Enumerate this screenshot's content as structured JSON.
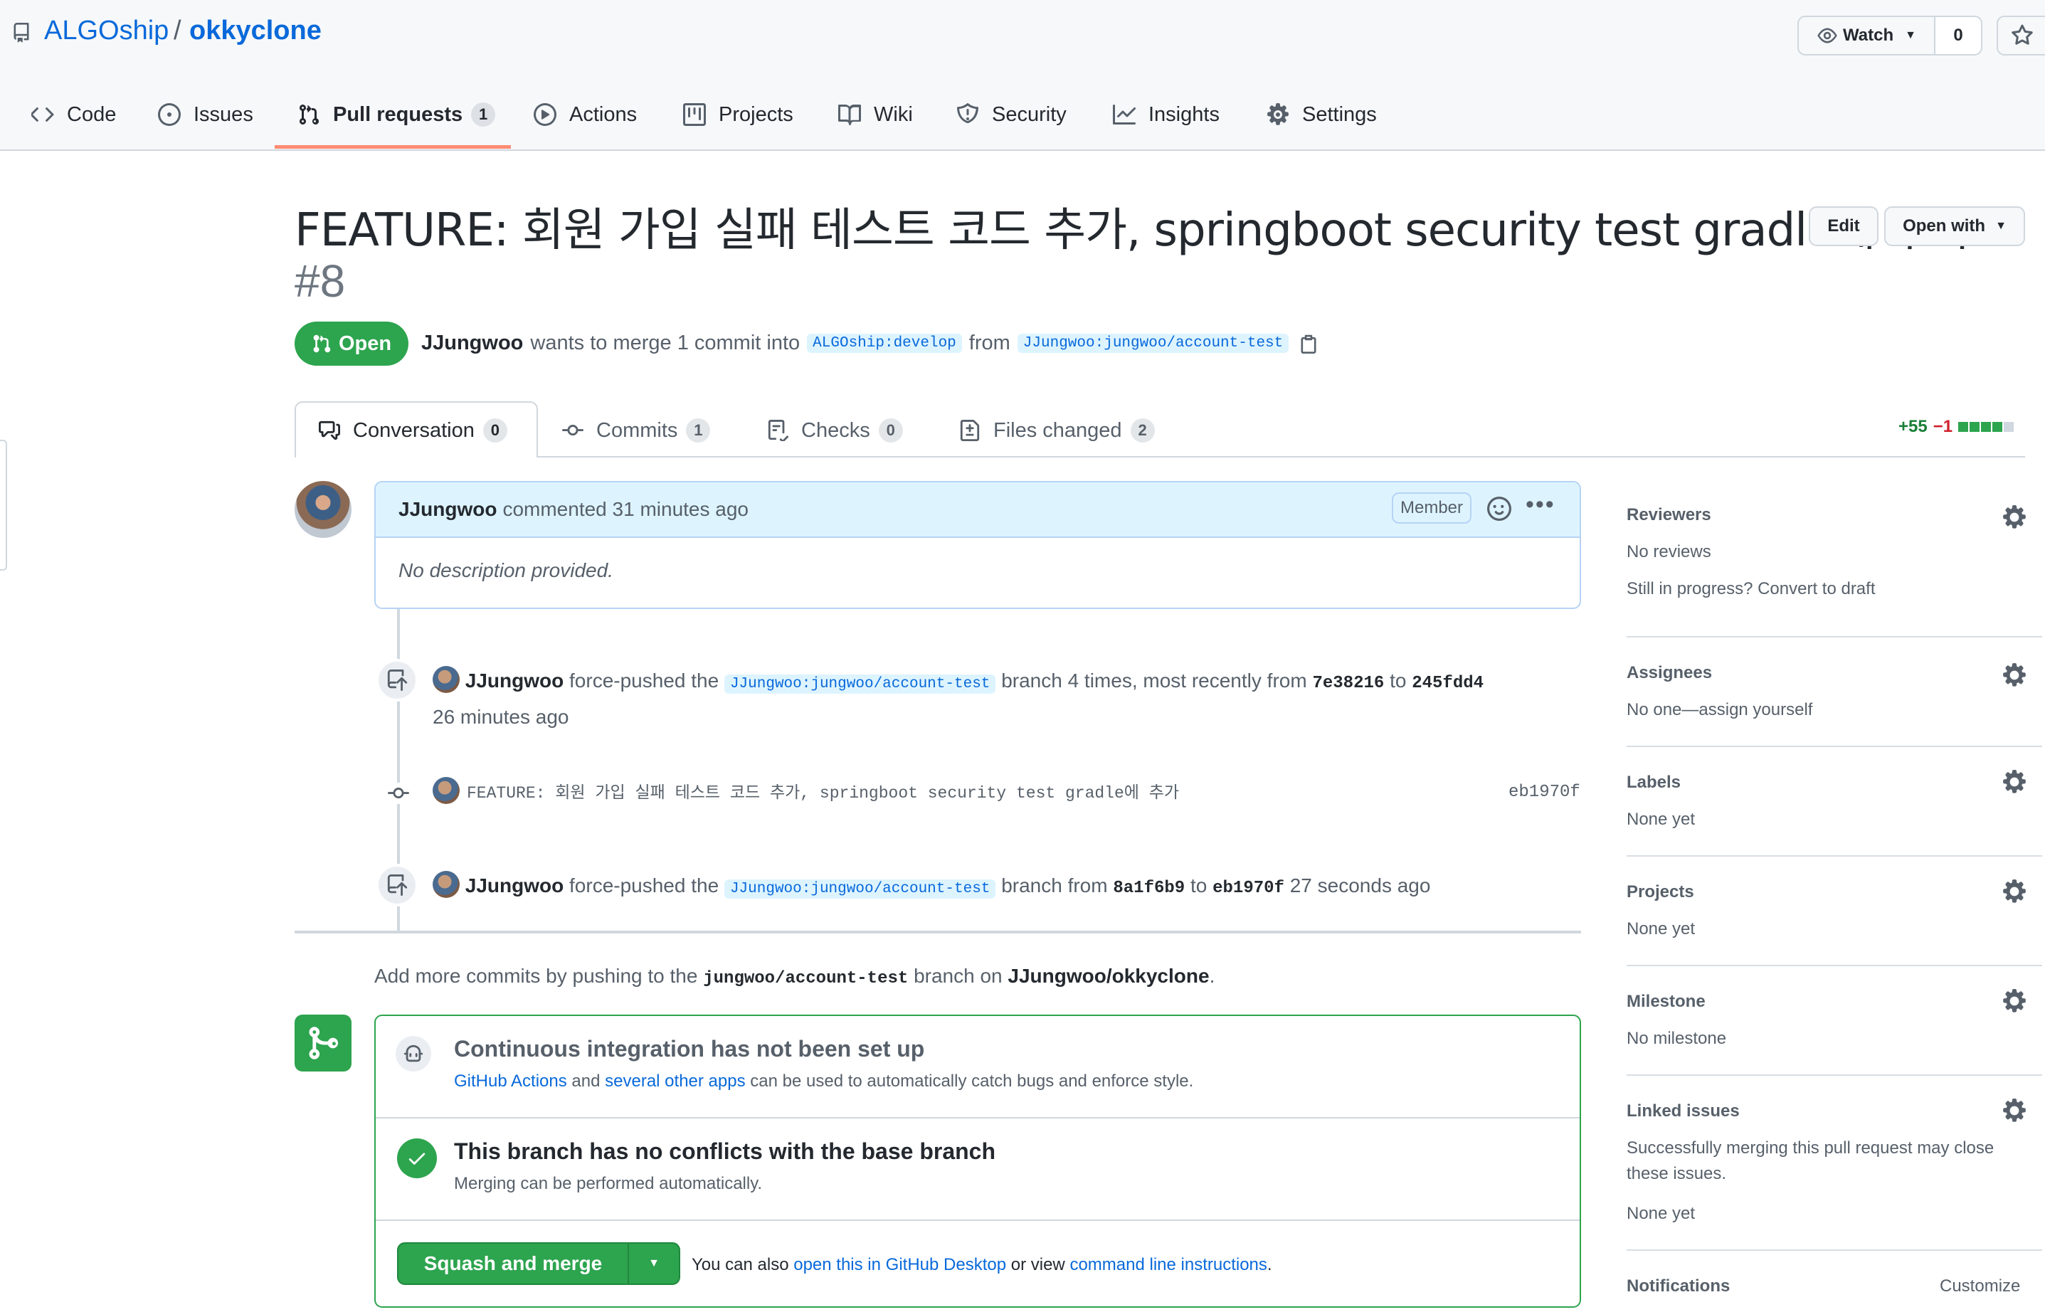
{
  "repo": {
    "owner": "ALGOship",
    "separator": "/",
    "name": "okkyclone"
  },
  "watch": {
    "label": "Watch",
    "count": "0"
  },
  "nav": [
    {
      "label": "Code",
      "icon": "code-icon"
    },
    {
      "label": "Issues",
      "icon": "issue-icon"
    },
    {
      "label": "Pull requests",
      "icon": "pull-request-icon",
      "count": "1",
      "selected": true
    },
    {
      "label": "Actions",
      "icon": "play-icon"
    },
    {
      "label": "Projects",
      "icon": "project-icon"
    },
    {
      "label": "Wiki",
      "icon": "book-icon"
    },
    {
      "label": "Security",
      "icon": "shield-icon"
    },
    {
      "label": "Insights",
      "icon": "graph-icon"
    },
    {
      "label": "Settings",
      "icon": "gear-icon"
    }
  ],
  "pr": {
    "title": "FEATURE: 회원 가입 실패 테스트 코드 추가, springboot security test gradle에 추가",
    "number": "#8",
    "edit_label": "Edit",
    "open_with_label": "Open with",
    "state": "Open",
    "author": "JJungwoo",
    "merge_text_1": "wants to merge 1 commit into",
    "base_branch": "ALGOship:develop",
    "from_text": "from",
    "head_branch": "JJungwoo:jungwoo/account-test"
  },
  "pr_tabs": [
    {
      "label": "Conversation",
      "count": "0",
      "icon": "comment-icon"
    },
    {
      "label": "Commits",
      "count": "1",
      "icon": "commit-icon"
    },
    {
      "label": "Checks",
      "count": "0",
      "icon": "checklist-icon"
    },
    {
      "label": "Files changed",
      "count": "2",
      "icon": "diff-icon"
    }
  ],
  "diffstat": {
    "additions": "+55",
    "deletions": "−1",
    "bar_fill": 0.8
  },
  "comment": {
    "author": "JJungwoo",
    "meta": "commented 31 minutes ago",
    "badge": "Member",
    "body": "No description provided."
  },
  "timeline": [
    {
      "author": "JJungwoo",
      "text1": "force-pushed the",
      "branch": "JJungwoo:jungwoo/account-test",
      "text2": "branch 4 times, most recently from",
      "from_sha": "7e38216",
      "to_text": "to",
      "to_sha": "245fdd4",
      "time": "26 minutes ago"
    },
    {
      "commit_message": "FEATURE: 회원 가입 실패 테스트 코드 추가, springboot security test gradle에 추가",
      "sha": "eb1970f"
    },
    {
      "author": "JJungwoo",
      "text1": "force-pushed the",
      "branch": "JJungwoo:jungwoo/account-test",
      "text2": "branch from",
      "from_sha": "8a1f6b9",
      "to_text": "to",
      "to_sha": "eb1970f",
      "time": "27 seconds ago"
    }
  ],
  "more_commits": {
    "text1": "Add more commits by pushing to the",
    "branch": "jungwoo/account-test",
    "text2": "branch on",
    "repo": "JJungwoo/okkyclone",
    "end": "."
  },
  "merge_box": {
    "ci_title": "Continuous integration has not been set up",
    "ci_link1": "GitHub Actions",
    "ci_and": "and",
    "ci_link2": "several other apps",
    "ci_rest": "can be used to automatically catch bugs and enforce style.",
    "conflict_title": "This branch has no conflicts with the base branch",
    "conflict_sub": "Merging can be performed automatically.",
    "merge_button": "Squash and merge",
    "also_text": "You can also",
    "desktop_link": "open this in GitHub Desktop",
    "or_view": "or view",
    "cli_link": "command line instructions",
    "period": "."
  },
  "sidebar": {
    "reviewers": {
      "title": "Reviewers",
      "line1": "No reviews",
      "line2": "Still in progress? Convert to draft"
    },
    "assignees": {
      "title": "Assignees",
      "line1": "No one—assign yourself"
    },
    "labels": {
      "title": "Labels",
      "line1": "None yet"
    },
    "projects": {
      "title": "Projects",
      "line1": "None yet"
    },
    "milestone": {
      "title": "Milestone",
      "line1": "No milestone"
    },
    "linked": {
      "title": "Linked issues",
      "line1": "Successfully merging this pull request may close",
      "line2": "these issues.",
      "line3": "None yet"
    },
    "notifications": {
      "title": "Notifications",
      "action": "Customize"
    }
  },
  "colors": {
    "green": "#2da44e",
    "link": "#0969da",
    "accent_tab": "#fd8c73"
  }
}
